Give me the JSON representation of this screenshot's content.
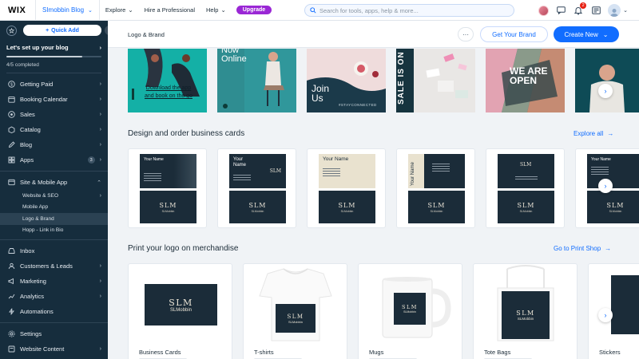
{
  "topbar": {
    "logo": "WIX",
    "site_name": "SImobbin Blog",
    "nav": [
      "Explore",
      "Hire a Professional",
      "Help"
    ],
    "upgrade": "Upgrade",
    "search_placeholder": "Search for tools, apps, help & more...",
    "notifications_count": "2"
  },
  "sidebar": {
    "quick_add": "Quick Add",
    "setup": {
      "title": "Let's set up your blog",
      "completed": "4/5 completed",
      "progress": 0.8
    },
    "items_a": [
      {
        "label": "Getting Paid",
        "icon": "dollar-icon"
      },
      {
        "label": "Booking Calendar",
        "icon": "calendar-icon"
      },
      {
        "label": "Sales",
        "icon": "sales-icon"
      },
      {
        "label": "Catalog",
        "icon": "catalog-icon"
      },
      {
        "label": "Blog",
        "icon": "blog-icon"
      },
      {
        "label": "Apps",
        "icon": "apps-icon",
        "badge": "3"
      }
    ],
    "site_mobile": {
      "label": "Site & Mobile App",
      "subitems": [
        "Website & SEO",
        "Mobile App",
        "Logo & Brand",
        "Hopp - Link in Bio"
      ],
      "active_index": 2
    },
    "items_b": [
      {
        "label": "Inbox",
        "icon": "inbox-icon"
      },
      {
        "label": "Customers & Leads",
        "icon": "customers-icon"
      },
      {
        "label": "Marketing",
        "icon": "marketing-icon"
      },
      {
        "label": "Analytics",
        "icon": "analytics-icon"
      },
      {
        "label": "Automations",
        "icon": "automations-icon"
      }
    ],
    "items_c": [
      {
        "label": "Settings",
        "icon": "settings-icon"
      },
      {
        "label": "Website Content",
        "icon": "website-content-icon"
      }
    ]
  },
  "page": {
    "title": "Logo & Brand",
    "more": "···",
    "get_brand": "Get Your Brand",
    "create_new": "Create New"
  },
  "banners": [
    {
      "text": "Download the app and book on the go"
    },
    {
      "text": "Now Online"
    },
    {
      "text": "Join Us",
      "tag": "#STAYCONNECTED"
    },
    {
      "text": "SALE IS ON"
    },
    {
      "text": "WE ARE OPEN"
    },
    {
      "text": ""
    }
  ],
  "business_cards": {
    "title": "Design and order business cards",
    "link": "Explore all",
    "cards": [
      {
        "name": "Your Name",
        "mark": "SLM",
        "brand": "SLMobbin"
      },
      {
        "name": "Your Name",
        "mark": "SLM",
        "brand": "SLMobbin"
      },
      {
        "name": "Your Name",
        "mark": "SLM",
        "brand": "SLMobbin"
      },
      {
        "name": "Your Name",
        "mark": "SLM",
        "brand": "SLMobbin"
      },
      {
        "name": "",
        "mark": "SLM",
        "brand": "SLMobbin"
      },
      {
        "name": "Your Name",
        "mark": "SLM",
        "brand": "SLMobbin"
      }
    ]
  },
  "merch": {
    "title": "Print your logo on merchandise",
    "link": "Go to Print Shop",
    "logo_mark": "SLM",
    "logo_name": "SLMobbin",
    "items": [
      "Business Cards",
      "T-shirts",
      "Mugs",
      "Tote Bags",
      "Stickers"
    ]
  }
}
